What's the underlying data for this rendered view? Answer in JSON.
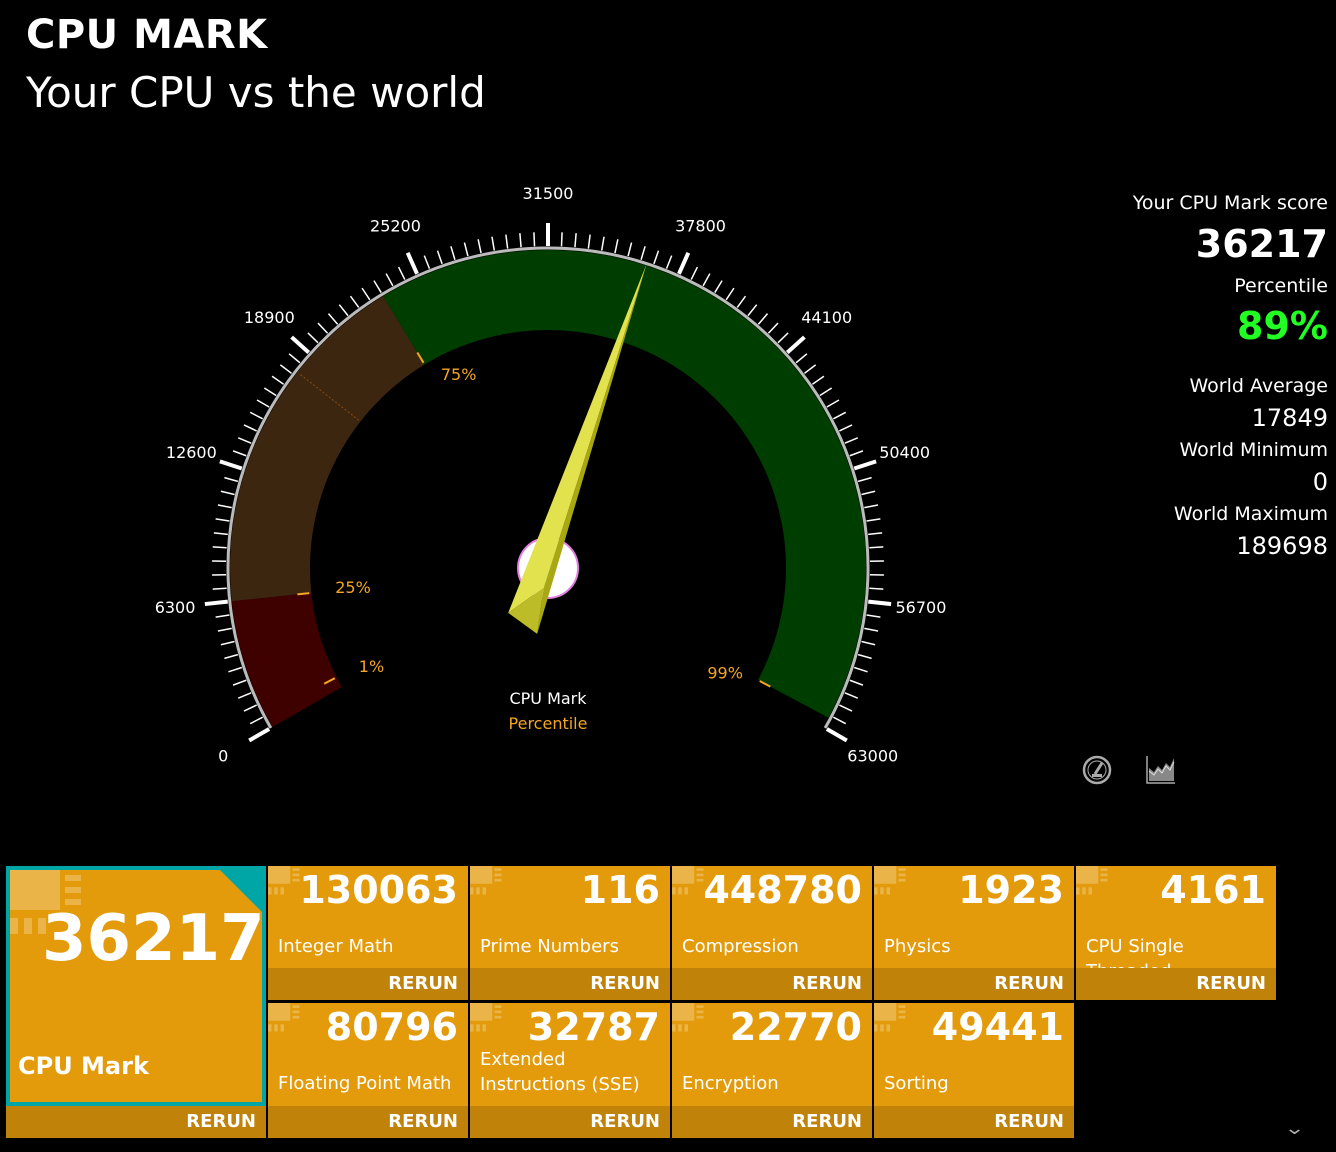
{
  "header": {
    "title": "CPU MARK",
    "subtitle": "Your CPU vs the world"
  },
  "gauge": {
    "min": 0,
    "max": 63000,
    "value": 36217,
    "major_ticks": [
      "0",
      "6300",
      "12600",
      "18900",
      "25200",
      "31500",
      "37800",
      "44100",
      "50400",
      "56700",
      "63000"
    ],
    "bands": [
      {
        "from": 0,
        "to": 6300,
        "color": "#3F0000"
      },
      {
        "from": 6300,
        "to": 23300,
        "color": "#3D2610"
      },
      {
        "from": 23300,
        "to": 62500,
        "color": "#003D00"
      }
    ],
    "percentile_markers": [
      {
        "label": "1%",
        "value": 700
      },
      {
        "label": "25%",
        "value": 6300
      },
      {
        "label": "75%",
        "value": 23300
      },
      {
        "label": "99%",
        "value": 62500
      }
    ],
    "average_line_value": 17849,
    "center_label": "CPU Mark",
    "center_sublabel": "Percentile",
    "marker_color": "#F5A623",
    "needle_color": "#E2E24E"
  },
  "summary": {
    "score_label": "Your CPU Mark score",
    "score": "36217",
    "percentile_label": "Percentile",
    "percentile": "89%",
    "percentile_color": "#22FF22",
    "avg_label": "World Average",
    "avg": "17849",
    "min_label": "World Minimum",
    "min": "0",
    "max_label": "World Maximum",
    "max": "189698"
  },
  "icons": {
    "gauge": "speedometer-icon",
    "chart": "area-chart-icon"
  },
  "main_tile": {
    "value": "36217",
    "label": "CPU Mark",
    "rerun": "RERUN"
  },
  "tiles": [
    {
      "value": "130063",
      "label": "Integer Math",
      "rerun": "RERUN"
    },
    {
      "value": "116",
      "label": "Prime Numbers",
      "rerun": "RERUN"
    },
    {
      "value": "448780",
      "label": "Compression",
      "rerun": "RERUN"
    },
    {
      "value": "1923",
      "label": "Physics",
      "rerun": "RERUN"
    },
    {
      "value": "4161",
      "label": "CPU Single Threaded",
      "rerun": "RERUN"
    },
    {
      "value": "80796",
      "label": "Floating Point Math",
      "rerun": "RERUN"
    },
    {
      "value": "32787",
      "label": "Extended Instructions (SSE)",
      "rerun": "RERUN"
    },
    {
      "value": "22770",
      "label": "Encryption",
      "rerun": "RERUN"
    },
    {
      "value": "49441",
      "label": "Sorting",
      "rerun": "RERUN"
    }
  ],
  "colors": {
    "tile": "#E39B0B",
    "tile_footer": "#C08208",
    "selected_border": "#00A6A6"
  }
}
